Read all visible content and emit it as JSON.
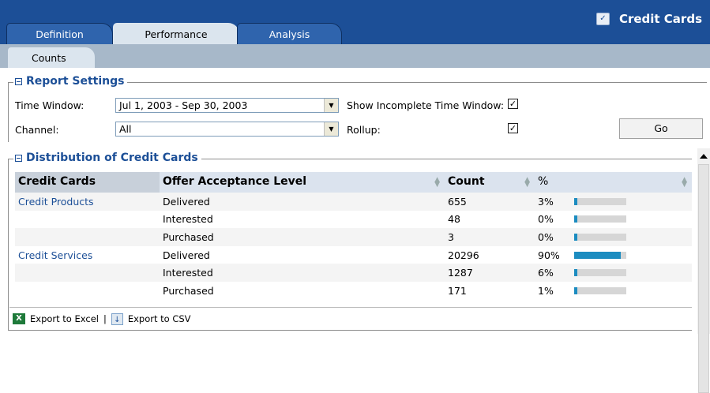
{
  "header": {
    "tabs": [
      {
        "label": "Definition",
        "active": false
      },
      {
        "label": "Performance",
        "active": true
      },
      {
        "label": "Analysis",
        "active": false
      }
    ],
    "title": "Credit Cards",
    "title_icon": "credit-card-icon",
    "bg_color": "#1c4f97"
  },
  "subtabs": {
    "active": "Counts"
  },
  "report_settings": {
    "legend": "Report Settings",
    "time_window_label": "Time Window:",
    "time_window_value": "Jul 1, 2003 - Sep 30, 2003",
    "channel_label": "Channel:",
    "channel_value": "All",
    "show_incomplete_label": "Show Incomplete Time Window:",
    "show_incomplete_checked": true,
    "rollup_label": "Rollup:",
    "rollup_checked": true,
    "go_label": "Go"
  },
  "distribution": {
    "legend": "Distribution of Credit Cards",
    "columns": [
      "Credit Cards",
      "Offer Acceptance Level",
      "Count",
      "%"
    ],
    "rows": [
      {
        "card": "Credit Products",
        "level": "Delivered",
        "count": "655",
        "pct": "3%",
        "fraction": 0.03
      },
      {
        "card": "",
        "level": "Interested",
        "count": "48",
        "pct": "0%",
        "fraction": 0.0
      },
      {
        "card": "",
        "level": "Purchased",
        "count": "3",
        "pct": "0%",
        "fraction": 0.0
      },
      {
        "card": "Credit Services",
        "level": "Delivered",
        "count": "20296",
        "pct": "90%",
        "fraction": 0.9
      },
      {
        "card": "",
        "level": "Interested",
        "count": "1287",
        "pct": "6%",
        "fraction": 0.06
      },
      {
        "card": "",
        "level": "Purchased",
        "count": "171",
        "pct": "1%",
        "fraction": 0.01
      }
    ],
    "export_excel": "Export to Excel",
    "export_separator": "|",
    "export_csv": "Export to CSV",
    "bar_color": "#1c8cc0"
  }
}
